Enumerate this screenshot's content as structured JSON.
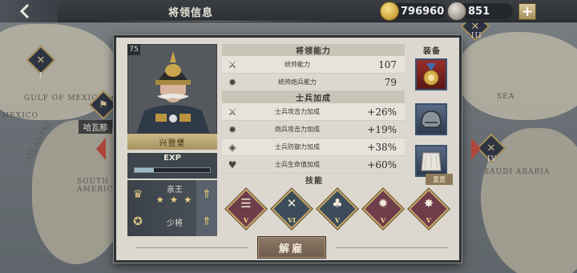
{
  "topbar": {
    "back_icon": "back-arrow-icon",
    "title": "将领信息",
    "gold": "796960",
    "medals": "851",
    "plus_label": "+"
  },
  "map": {
    "labels": [
      "哈瓦那"
    ],
    "place_texts": [
      "GULF OF MEXICO",
      "SOUTH AMERICA",
      "SAUDI ARABIA",
      "MEXICO",
      "ATLANTIC",
      "SEA"
    ],
    "markers": [
      "I",
      "III",
      "IV"
    ]
  },
  "general": {
    "name": "兴登堡",
    "corner_badge": "75",
    "exp_label": "EXP",
    "exp_progress": 0.25,
    "title_rank": "亲王",
    "title_stars": "★ ★ ★",
    "military_rank": "少将",
    "up_icon": "upgrade-arrow-icon"
  },
  "abilities": {
    "header": "将领能力",
    "rows": [
      {
        "icon": "crossed-swords-icon",
        "name": "统帅能力",
        "value": "107"
      },
      {
        "icon": "cannon-icon",
        "name": "统帅炮兵能力",
        "value": "79"
      }
    ]
  },
  "bonuses": {
    "header": "士兵加成",
    "rows": [
      {
        "icon": "attack-icon",
        "name": "士兵攻击力加成",
        "value": "+26%"
      },
      {
        "icon": "artillery-attack-icon",
        "name": "炮兵攻击力加成",
        "value": "+19%"
      },
      {
        "icon": "defense-icon",
        "name": "士兵防御力加成",
        "value": "+38%"
      },
      {
        "icon": "heart-icon",
        "name": "士兵生命值加成",
        "value": "+60%"
      }
    ]
  },
  "equipment": {
    "header": "装备",
    "items": [
      "medal-icon",
      "helmet-icon",
      "cloak-icon"
    ]
  },
  "skills": {
    "header": "技能",
    "reset_label": "重置",
    "items": [
      {
        "icon": "infantry-skill-icon",
        "level": "V",
        "color": "#6e3d4a"
      },
      {
        "icon": "rifle-skill-icon",
        "level": "VI",
        "color": "#3d4c5a"
      },
      {
        "icon": "forest-skill-icon",
        "level": "V",
        "color": "#3d4c5a"
      },
      {
        "icon": "cannon-skill-icon",
        "level": "V",
        "color": "#6e3d4a"
      },
      {
        "icon": "artillery-skill-icon",
        "level": "V",
        "color": "#6e3d4a"
      }
    ]
  },
  "actions": {
    "dismiss_label": "解雇"
  },
  "colors": {
    "accent_gold": "#cbb889",
    "dialog_bg": "#dcd8cf",
    "button_brown": "#8d7a68"
  }
}
